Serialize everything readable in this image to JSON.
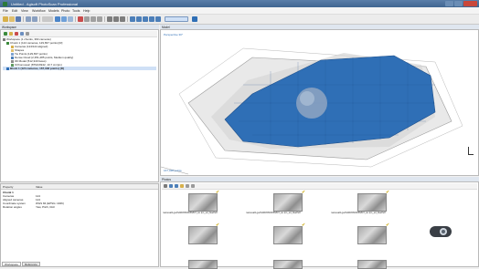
{
  "window": {
    "title": "Untitled - Agisoft PhotoScan Professional"
  },
  "menubar": {
    "items": [
      "File",
      "Edit",
      "View",
      "Workflow",
      "Models",
      "Photo",
      "Tools",
      "Help"
    ]
  },
  "workspace": {
    "title": "Workspace",
    "items": [
      "Workspace (1 chunks, 390 cameras)",
      "Chunk 1 (124 cameras, 129,837 points) [R]",
      "Cameras (124/124 aligned)",
      "Shapes",
      "Tie Points (129,837 points)",
      "Dense Cloud (2,351,285 points, Medium quality)",
      "3D Model (512,340 faces)",
      "Orthomosaic (8792x6942, 10.7 cm/pix)",
      "Block 1 (124 cameras, 167,348 points) [R]"
    ]
  },
  "model": {
    "title": "Model",
    "perspective": "Perspective 30°",
    "footer": "167,348 points"
  },
  "properties": {
    "headers": [
      "Property",
      "Value"
    ],
    "rows": [
      {
        "k": "Chunk 1",
        "v": ""
      },
      {
        "k": "Cameras",
        "v": "124"
      },
      {
        "k": "Aligned cameras",
        "v": "124"
      },
      {
        "k": "Coordinate system",
        "v": "WGS 84 (EPSG::4326)"
      },
      {
        "k": "Rotation angles",
        "v": "Yaw, Pitch, Roll"
      }
    ],
    "tabs": [
      "Workspace",
      "Reference"
    ]
  },
  "photos": {
    "title": "Photos",
    "items": [
      "namesalli.gedhdfd45660056807_ko.i(in_ed_fkadhdf",
      "namesalli.gedhdfd45660056807_ko.i(in_ed_fkadhdf",
      "namesalli.gedhdfd45660056807_ko.i(in_ed_fkadhdf"
    ]
  },
  "colors": {
    "accent": "#2f6fb6",
    "selection": "#cfe0f6"
  }
}
